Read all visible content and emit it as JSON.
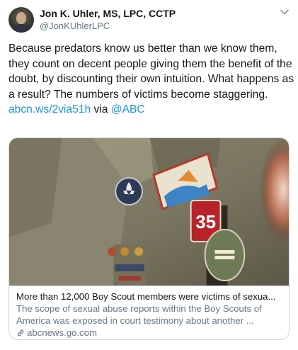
{
  "author": {
    "display_name": "Jon K. Uhler, MS, LPC, CCTP",
    "handle": "@JonKUhlerLPC"
  },
  "tweet": {
    "text_before_link": "Because predators know us better than we know them, they count on decent people giving them the benefit of the doubt, by discounting their own intuition. What happens as a result? The numbers of victims become staggering. ",
    "link": "abcn.ws/2via51h",
    "text_after_link": " via ",
    "mention": "@ABC"
  },
  "card": {
    "title": "More than 12,000 Boy Scout members were victims of sexua...",
    "description": "The scope of sexual abuse reports within the Boy Scouts of America was exposed in court testimony about another ...",
    "domain": "abcnews.go.com",
    "image_patch_text": "35"
  },
  "icons": {
    "menu": "chevron-down-icon",
    "domain": "link-icon"
  },
  "colors": {
    "link": "#1b95e0",
    "secondary_text": "#657786",
    "border": "#ccd6dd"
  }
}
